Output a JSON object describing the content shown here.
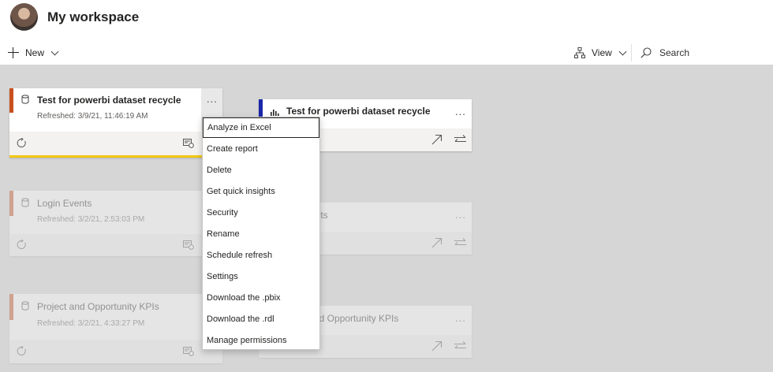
{
  "header": {
    "title": "My workspace",
    "new_label": "New",
    "view_label": "View",
    "search_placeholder": "Search"
  },
  "cards": [
    {
      "title": "Test for powerbi dataset recycle",
      "refreshed": "Refreshed: 3/9/21, 11:46:19 AM",
      "accent": "#c8501d",
      "type": "dataset"
    },
    {
      "title": "Test for powerbi dataset recycle",
      "accent": "#1a27a8",
      "type": "report"
    },
    {
      "title": "Login Events",
      "refreshed": "Refreshed: 3/2/21, 2:53:03 PM",
      "accent": "#c8501d",
      "type": "dataset"
    },
    {
      "title": "ents",
      "accent": "#1a27a8",
      "type": "report"
    },
    {
      "title": "Project and Opportunity KPIs",
      "refreshed": "Refreshed: 3/2/21, 4:33:27 PM",
      "accent": "#c8501d",
      "type": "dataset"
    },
    {
      "title": "nd Opportunity KPIs",
      "accent": "#1a27a8",
      "type": "report"
    }
  ],
  "more_glyph": "...",
  "context_menu": {
    "items": [
      "Analyze in Excel",
      "Create report",
      "Delete",
      "Get quick insights",
      "Security",
      "Rename",
      "Schedule refresh",
      "Settings",
      "Download the .pbix",
      "Download the .rdl",
      "Manage permissions"
    ]
  },
  "colors": {
    "selected_underline": "#f2c811",
    "dataset_accent": "#c8501d",
    "report_accent": "#1a27a8",
    "canvas": "#d6d6d6"
  },
  "icons": [
    "avatar",
    "plus-icon",
    "chevron-down-icon",
    "lineage-view-icon",
    "search-icon",
    "dataset-icon",
    "report-chart-icon",
    "refresh-icon",
    "schedule-icon",
    "open-arrow-icon",
    "swap-icon",
    "more-icon"
  ]
}
